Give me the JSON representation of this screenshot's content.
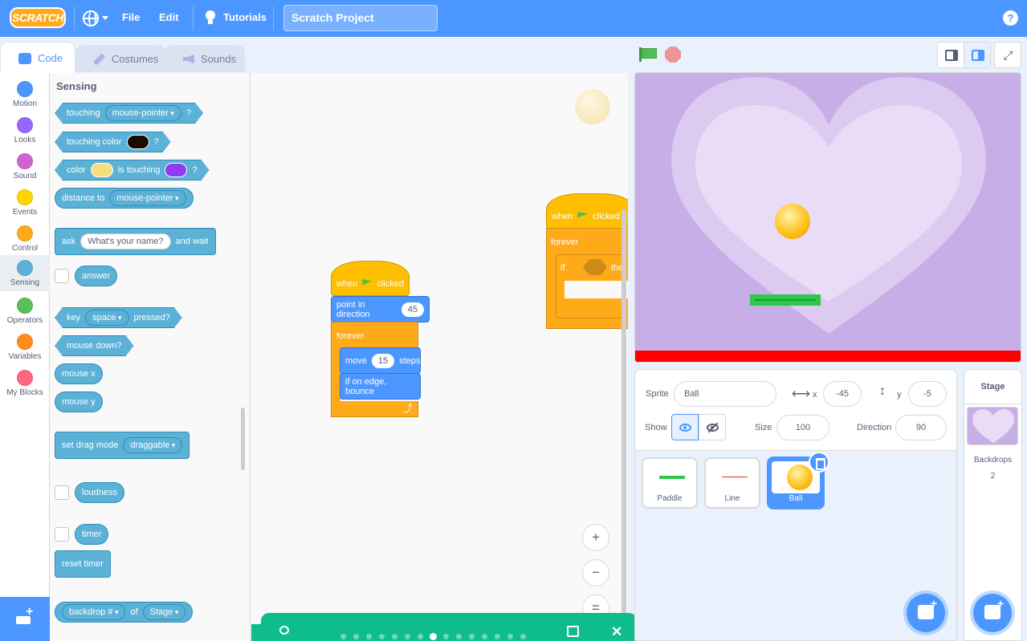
{
  "menubar": {
    "logo": "SCRATCH",
    "file": "File",
    "edit": "Edit",
    "tutorials": "Tutorials",
    "project_title": "Scratch Project",
    "help": "?"
  },
  "tabs": {
    "code": "Code",
    "costumes": "Costumes",
    "sounds": "Sounds"
  },
  "categories": [
    {
      "label": "Motion",
      "color": "#4c97ff"
    },
    {
      "label": "Looks",
      "color": "#9966ff"
    },
    {
      "label": "Sound",
      "color": "#cf63cf"
    },
    {
      "label": "Events",
      "color": "#ffd500"
    },
    {
      "label": "Control",
      "color": "#ffab19"
    },
    {
      "label": "Sensing",
      "color": "#5cb1d6"
    },
    {
      "label": "Operators",
      "color": "#59c059"
    },
    {
      "label": "Variables",
      "color": "#ff8c1a"
    },
    {
      "label": "My Blocks",
      "color": "#ff6680"
    }
  ],
  "flyout": {
    "title": "Sensing",
    "touching": "touching",
    "touching_target": "mouse-pointer",
    "q": "?",
    "touching_color": "touching color",
    "touching_color_value": "#1a0a00",
    "color": "color",
    "color_value_1": "#f7df7e",
    "is_touching": "is touching",
    "color_value_2": "#8f3cf0",
    "distance_to": "distance to",
    "distance_target": "mouse-pointer",
    "ask": "ask",
    "ask_text": "What's your name?",
    "and_wait": "and wait",
    "answer": "answer",
    "key": "key",
    "key_value": "space",
    "pressed": "pressed?",
    "mouse_down": "mouse down?",
    "mouse_x": "mouse x",
    "mouse_y": "mouse y",
    "set_drag_mode": "set drag mode",
    "drag_value": "draggable",
    "loudness": "loudness",
    "timer": "timer",
    "reset_timer": "reset timer",
    "backdrop": "backdrop #",
    "of": "of",
    "stage": "Stage"
  },
  "script1": {
    "when": "when",
    "clicked": "clicked",
    "point_in_direction": "point in direction",
    "direction_value": "45",
    "forever": "forever",
    "move": "move",
    "steps_value": "15",
    "steps": "steps",
    "if_on_edge": "if on edge, bounce"
  },
  "script2": {
    "when": "when",
    "clicked": "clicked",
    "forever": "forever",
    "if": "if",
    "then": "the"
  },
  "sprite_info": {
    "sprite_label": "Sprite",
    "sprite_name": "Ball",
    "x_label": "x",
    "x_value": "-45",
    "y_label": "y",
    "y_value": "-5",
    "show_label": "Show",
    "size_label": "Size",
    "size_value": "100",
    "direction_label": "Direction",
    "direction_value": "90"
  },
  "sprites": [
    {
      "name": "Paddle"
    },
    {
      "name": "Line"
    },
    {
      "name": "Ball"
    }
  ],
  "stage_pane": {
    "title": "Stage",
    "backdrops_label": "Backdrops",
    "backdrops_count": "2"
  }
}
